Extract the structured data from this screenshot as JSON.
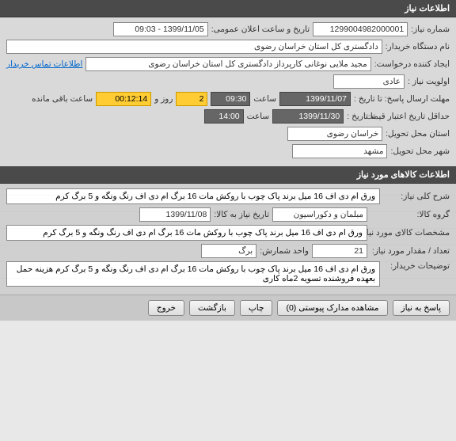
{
  "section1": {
    "title": "اطلاعات نیاز",
    "need_number_label": "شماره نیاز:",
    "need_number": "1299004982000001",
    "announce_label": "تاریخ و ساعت اعلان عمومی:",
    "announce_value": "1399/11/05 - 09:03",
    "buyer_label": "نام دستگاه خریدار:",
    "buyer_value": "دادگستری کل استان خراسان رضوی",
    "creator_label": "ایجاد کننده درخواست:",
    "creator_value": "مجید ملایی نوغانی کارپرداز دادگستری کل استان خراسان رضوی",
    "contact_link": "اطلاعات تماس خریدار",
    "priority_label": "اولویت نیاز :",
    "priority_value": "عادی",
    "deadline_label": "مهلت ارسال پاسخ:  تا تاریخ :",
    "deadline_date": "1399/11/07",
    "time_label": "ساعت",
    "deadline_time": "09:30",
    "days_value": "2",
    "days_label": "روز و",
    "countdown": "00:12:14",
    "remaining_label": "ساعت باقی مانده",
    "validity_label": "حداقل تاریخ اعتبار قیمت:",
    "validity_until_label": "تا تاریخ :",
    "validity_date": "1399/11/30",
    "validity_time": "14:00",
    "province_label": "استان محل تحویل:",
    "province_value": "خراسان رضوی",
    "city_label": "شهر محل تحویل:",
    "city_value": "مشهد"
  },
  "section2": {
    "title": "اطلاعات کالاهای مورد نیاز",
    "desc_label": "شرح کلی نیاز:",
    "desc_value": "ورق ام دی اف 16 میل برند  پاک چوب با روکش مات 16 برگ ام دی اف رنگ ونگه و 5 برگ کرم",
    "group_label": "گروه کالا:",
    "group_value": "مبلمان و دکوراسیون",
    "goods_date_label": "تاریخ نیاز به کالا:",
    "goods_date_value": "1399/11/08",
    "spec_label": "مشخصات کالای مورد نیاز:",
    "spec_value": "ورق ام دی اف 16 میل برند  پاک چوب با روکش مات 16 برگ ام دی اف رنگ ونگه و 5 برگ کرم",
    "qty_label": "تعداد / مقدار مورد نیاز:",
    "qty_value": "21",
    "unit_label": "واحد شمارش:",
    "unit_value": "برگ",
    "buyer_notes_label": "توضیحات خریدار:",
    "buyer_notes_value": "ورق ام دی اف 16 میل برند  پاک چوب با روکش مات 16 برگ ام دی اف رنگ ونگه و 5 برگ کرم  هزینه حمل بعهده فروشنده تسویه 2ماه کاری"
  },
  "buttons": {
    "respond": "پاسخ به نیاز",
    "attachments": "مشاهده مدارک پیوستی (0)",
    "print": "چاپ",
    "back": "بازگشت",
    "exit": "خروج"
  }
}
